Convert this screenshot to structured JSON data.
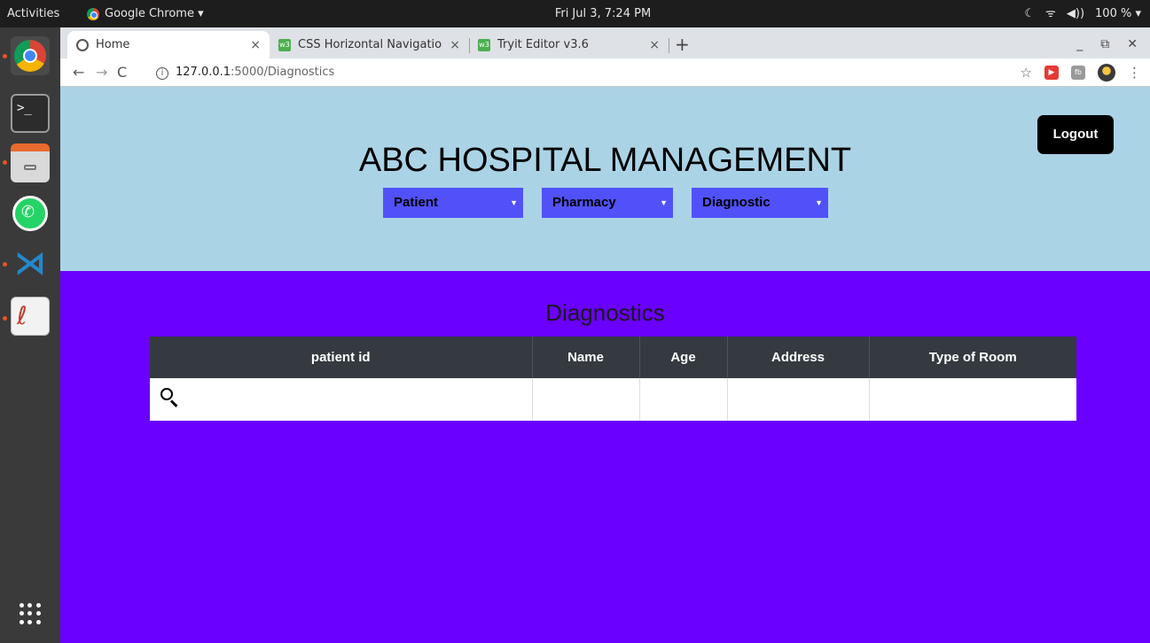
{
  "system_bar": {
    "activities": "Activities",
    "app_name": "Google Chrome ▾",
    "clock": "Fri Jul  3,  7:24 PM",
    "status": {
      "moon": "☾",
      "wifi": "ᯤ",
      "volume": "◀))",
      "battery": "100 % ▾"
    }
  },
  "dock": {
    "items": [
      "chrome-icon",
      "terminal-icon",
      "files-icon",
      "whatsapp-icon",
      "vscode-icon",
      "text-editor-icon",
      "show-apps-icon"
    ],
    "terminal_prompt": ">_"
  },
  "browser": {
    "tabs": [
      {
        "title": "Home",
        "active": true
      },
      {
        "title": "CSS Horizontal Navigatio",
        "active": false
      },
      {
        "title": "Tryit Editor v3.6",
        "active": false
      }
    ],
    "tab_close": "×",
    "new_tab": "+",
    "window_controls": {
      "minimize": "_",
      "restore": "⧉",
      "close": "✕"
    },
    "nav": {
      "back": "←",
      "forward": "→",
      "reload": "C"
    },
    "url_host": "127.0.0.1",
    "url_path": ":5000/Diagnostics",
    "bookmark": "☆",
    "menu": "⋮",
    "ext1": "▶",
    "ext2": "fb"
  },
  "page": {
    "title": "ABC HOSPITAL MANAGEMENT",
    "logout_label": "Logout",
    "menus": [
      {
        "label": "Patient",
        "caret": "▼"
      },
      {
        "label": "Pharmacy",
        "caret": "▼"
      },
      {
        "label": "Diagnostic",
        "caret": "▼"
      }
    ],
    "section_title": "Diagnostics",
    "table": {
      "headers": [
        "patient id",
        "Name",
        "Age",
        "Address",
        "Type of Room"
      ]
    },
    "colors": {
      "header_bg": "#abd3e6",
      "body_bg": "#6a00ff",
      "menu_bg": "#5151fa",
      "table_header_bg": "#343a40"
    }
  }
}
